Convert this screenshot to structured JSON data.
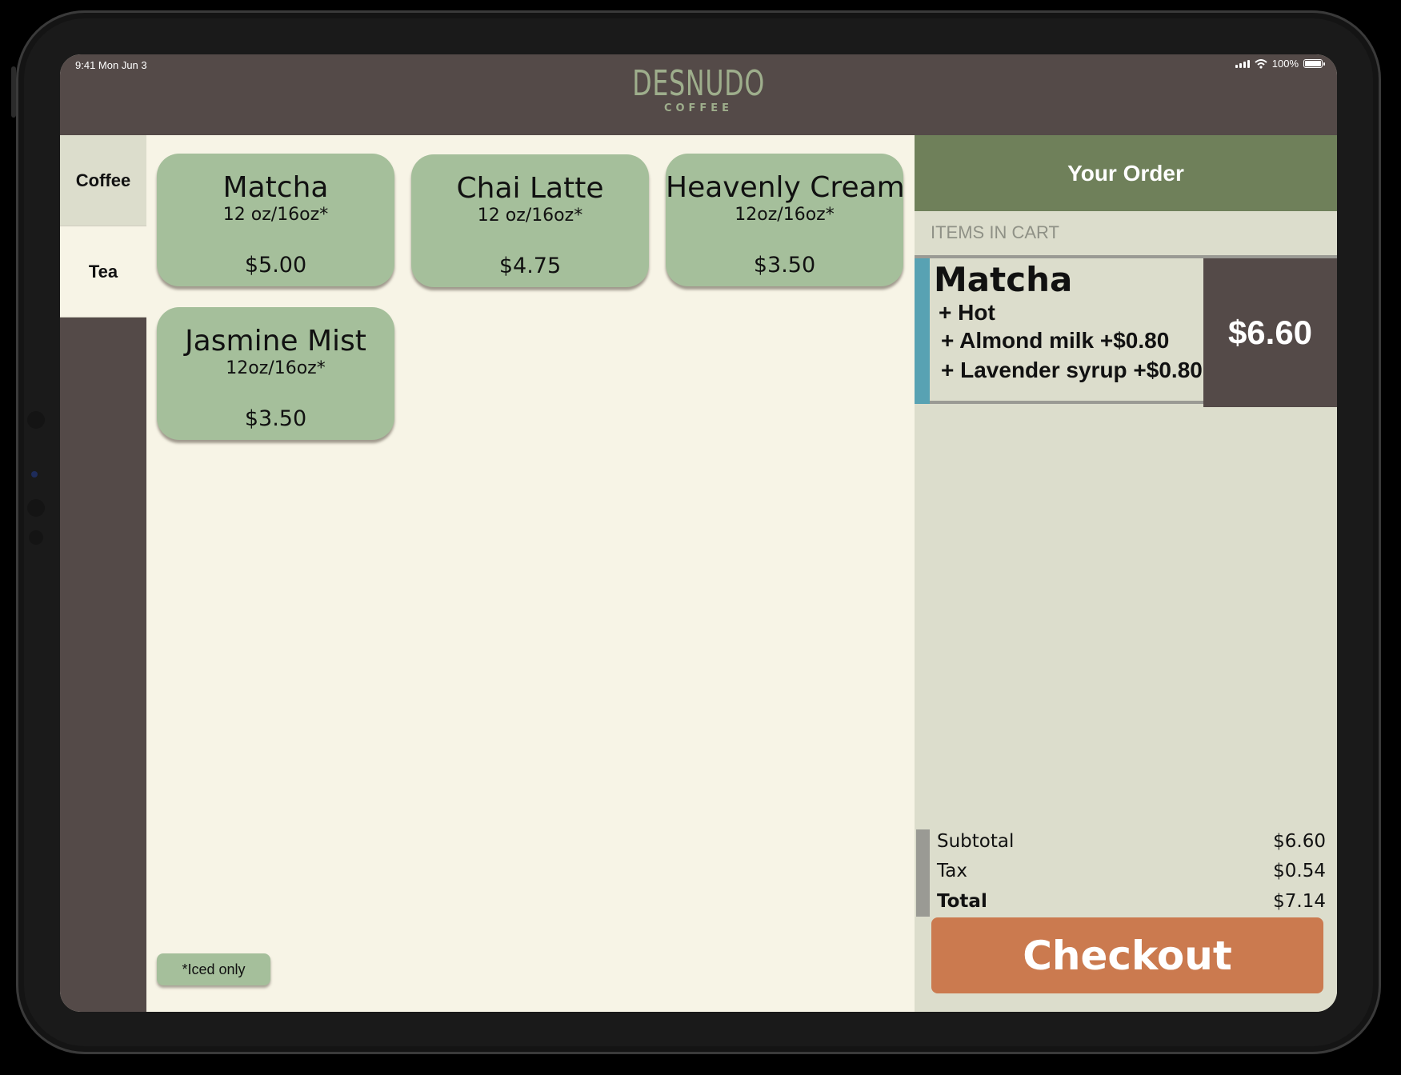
{
  "status_bar": {
    "time": "9:41  Mon Jun 3",
    "battery": "100%"
  },
  "brand": {
    "name": "DESNUDO",
    "sub": "COFFEE",
    "color": "#9eae8c"
  },
  "categories": [
    {
      "label": "Coffee",
      "selected": false
    },
    {
      "label": "Tea",
      "selected": true
    }
  ],
  "menu_items": [
    {
      "name": "Matcha",
      "size": "12 oz/16oz*",
      "price": "$5.00"
    },
    {
      "name": "Chai Latte",
      "size": "12 oz/16oz*",
      "price": "$4.75"
    },
    {
      "name": "Heavenly Cream",
      "size": "12oz/16oz*",
      "price": "$3.50"
    },
    {
      "name": "Jasmine Mist",
      "size": "12oz/16oz*",
      "price": "$3.50"
    }
  ],
  "iced_note": "*Iced only",
  "order": {
    "title": "Your Order",
    "items_label": "ITEMS IN CART",
    "items": [
      {
        "name": "Matcha",
        "modifiers": [
          "+ Hot",
          "+ Almond milk +$0.80",
          "+ Lavender syrup +$0.80"
        ],
        "price": "$6.60"
      }
    ],
    "totals": {
      "subtotal_label": "Subtotal",
      "subtotal": "$6.60",
      "tax_label": "Tax",
      "tax": "$0.54",
      "total_label": "Total",
      "total": "$7.14"
    },
    "checkout_label": "Checkout"
  },
  "colors": {
    "topbar": "#544a48",
    "card": "#a5bf9b",
    "order_header": "#6f805a",
    "cart_accent": "#58a2b3",
    "checkout": "#cb7a4f",
    "background": "#f7f4e6"
  }
}
